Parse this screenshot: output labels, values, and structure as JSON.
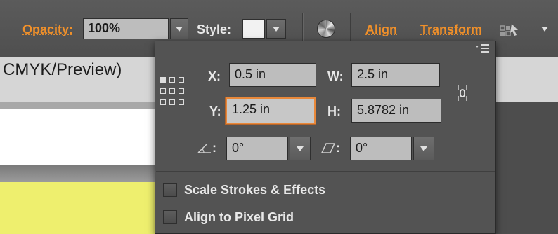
{
  "control_bar": {
    "opacity_label": "Opacity:",
    "opacity_value": "100%",
    "style_label": "Style:",
    "align_label": "Align",
    "transform_label": "Transform"
  },
  "document": {
    "tab_title": "CMYK/Preview)"
  },
  "transform_panel": {
    "x_label": "X:",
    "x_value": "0.5 in",
    "y_label": "Y:",
    "y_value": "1.25 in",
    "w_label": "W:",
    "w_value": "2.5 in",
    "h_label": "H:",
    "h_value": "5.8782 in",
    "rotate_value": "0°",
    "shear_value": "0°",
    "scale_strokes_label": "Scale Strokes & Effects",
    "align_pixel_label": "Align to Pixel Grid"
  },
  "colors": {
    "accent_orange": "#f0902a",
    "panel_bg": "#535353",
    "field_bg": "#bdbdbd",
    "document_yellow": "#eeef6e"
  }
}
